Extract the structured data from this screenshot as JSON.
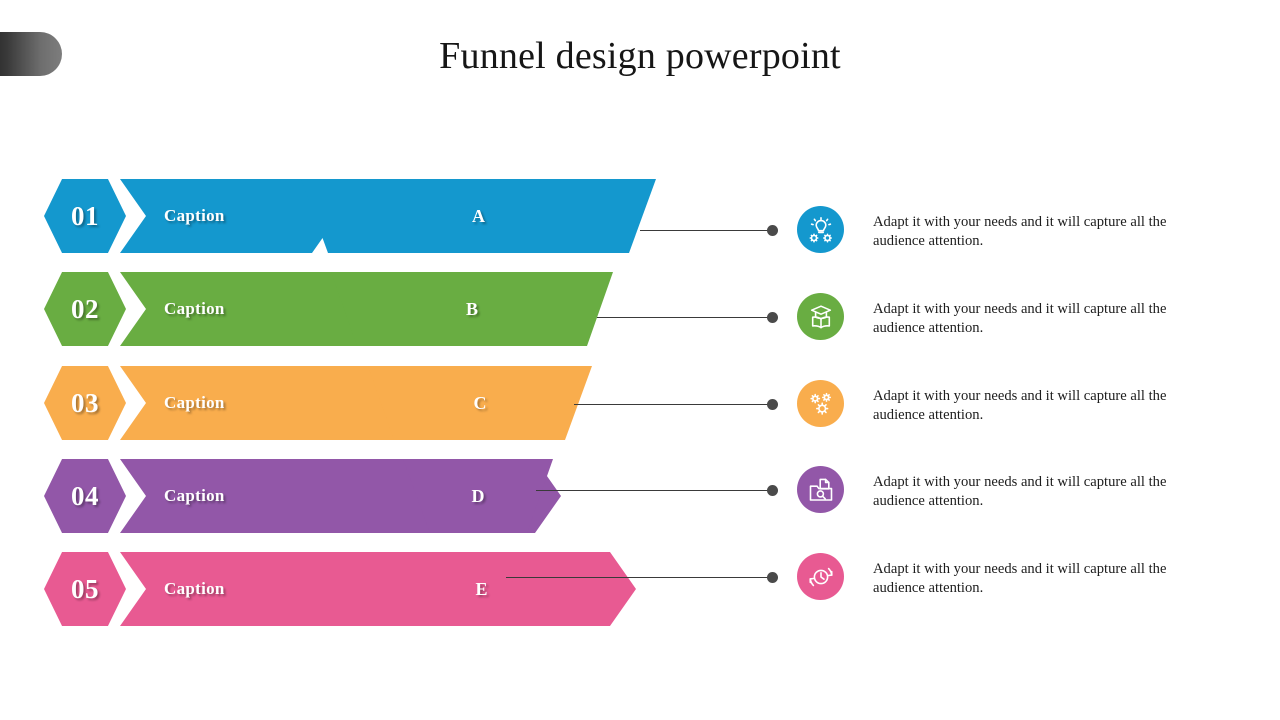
{
  "slide": {
    "title": "Funnel design powerpoint",
    "corner_tab": "corner-tab"
  },
  "rows": [
    {
      "number": "01",
      "caption": "Caption",
      "segment_label": "A",
      "color": "#1498ce",
      "icon": "idea-bulb-gears-icon",
      "description": "Adapt it with your needs and it will capture all the audience attention."
    },
    {
      "number": "02",
      "caption": "Caption",
      "segment_label": "B",
      "color": "#69ad42",
      "icon": "graduation-book-icon",
      "description": "Adapt it with your needs and it will capture all the audience attention."
    },
    {
      "number": "03",
      "caption": "Caption",
      "segment_label": "C",
      "color": "#f9ad4d",
      "icon": "gears-settings-icon",
      "description": "Adapt it with your needs and it will capture all the audience attention."
    },
    {
      "number": "04",
      "caption": "Caption",
      "segment_label": "D",
      "color": "#9257a8",
      "icon": "folder-search-icon",
      "description": "Adapt it with your needs and it will capture all the audience attention."
    },
    {
      "number": "05",
      "caption": "Caption",
      "segment_label": "E",
      "color": "#e85a92",
      "icon": "clock-history-icon",
      "description": "Adapt it with your needs and it will capture all the audience attention."
    }
  ]
}
